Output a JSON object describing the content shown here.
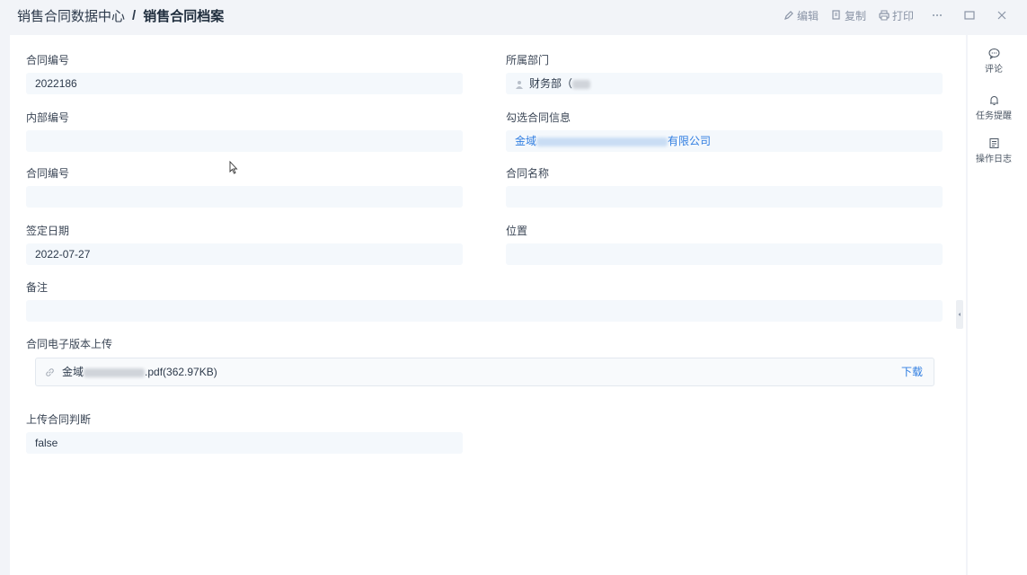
{
  "header": {
    "breadcrumb_parent": "销售合同数据中心",
    "breadcrumb_sep": "/",
    "breadcrumb_current": "销售合同档案",
    "actions": {
      "edit": "编辑",
      "copy": "复制",
      "print": "打印"
    }
  },
  "form": {
    "contract_no_1": {
      "label": "合同编号",
      "value": "2022186"
    },
    "department": {
      "label": "所属部门",
      "value": "财务部（"
    },
    "internal_no": {
      "label": "内部编号",
      "value": ""
    },
    "selected_contract": {
      "label": "勾选合同信息",
      "value_prefix": "金域",
      "value_suffix": "有限公司"
    },
    "contract_no_2": {
      "label": "合同编号",
      "value": ""
    },
    "contract_name": {
      "label": "合同名称",
      "value": ""
    },
    "sign_date": {
      "label": "签定日期",
      "value": "2022-07-27"
    },
    "location": {
      "label": "位置",
      "value": ""
    },
    "remark": {
      "label": "备注",
      "value": ""
    },
    "upload": {
      "label": "合同电子版本上传",
      "file_prefix": "金域",
      "file_suffix": ".pdf(362.97KB)",
      "download": "下载"
    },
    "upload_judge": {
      "label": "上传合同判断",
      "value": "false"
    }
  },
  "sidebar": {
    "comment": "评论",
    "task_reminder": "任务提醒",
    "operation_log": "操作日志"
  }
}
